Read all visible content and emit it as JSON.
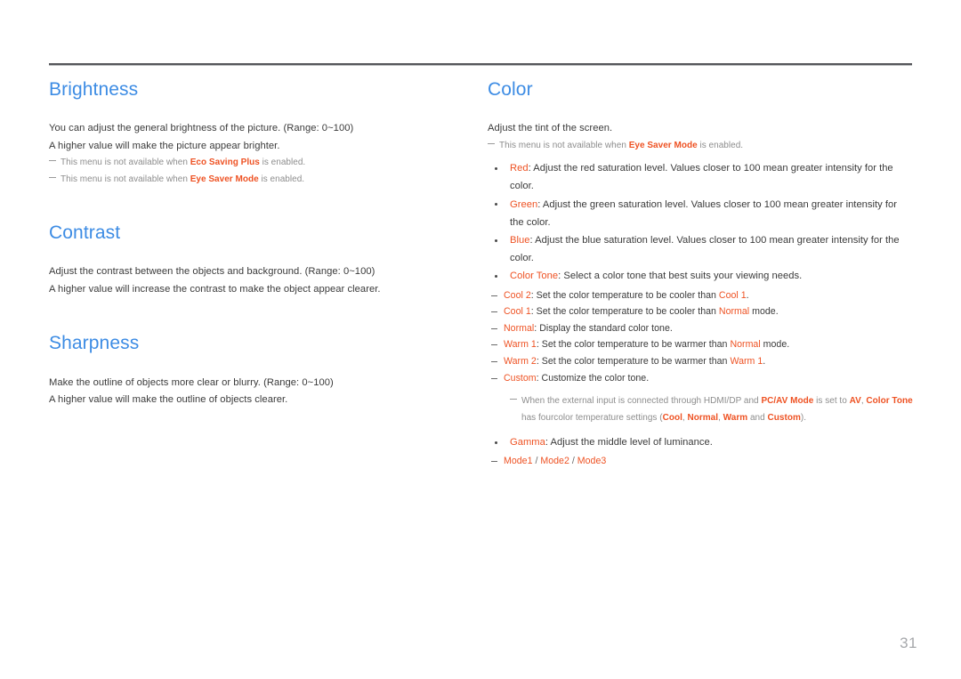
{
  "page": {
    "number": "31",
    "accent_blue": "#3d8ce4",
    "accent_orange": "#ee5223",
    "body_color": "#3a3a3a",
    "note_color": "#8d8d8d"
  },
  "left_column": {
    "sections": [
      {
        "title": "Brightness",
        "paragraphs": [
          "You can adjust the general brightness of the picture. (Range: 0~100)",
          "A higher value will make the picture appear brighter."
        ],
        "notes": [
          {
            "pre": "This menu is not available when ",
            "hl": "Eco Saving Plus",
            "post": " is enabled."
          },
          {
            "pre": "This menu is not available when ",
            "hl": "Eye Saver Mode",
            "post": " is enabled."
          }
        ]
      },
      {
        "title": "Contrast",
        "paragraphs": [
          "Adjust the contrast between the objects and background. (Range: 0~100)",
          "A higher value will increase the contrast to make the object appear clearer."
        ],
        "notes": []
      },
      {
        "title": "Sharpness",
        "paragraphs": [
          "Make the outline of objects more clear or blurry. (Range: 0~100)",
          "A higher value will make the outline of objects clearer."
        ],
        "notes": []
      }
    ]
  },
  "right_column": {
    "title": "Color",
    "intro": "Adjust the tint of the screen.",
    "intro_note": {
      "pre": "This menu is not available when ",
      "hl": "Eye Saver Mode",
      "post": " is enabled."
    },
    "bullets": {
      "red_label": "Red",
      "red_text": ": Adjust the red saturation level. Values closer to 100 mean greater intensity for the color.",
      "green_label": "Green",
      "green_text": ": Adjust the green saturation level. Values closer to 100 mean greater intensity for the color.",
      "blue_label": "Blue",
      "blue_text": ": Adjust the blue saturation level. Values closer to 100 mean greater intensity for the color.",
      "color_tone_label": "Color Tone",
      "color_tone_text": ": Select a color tone that best suits your viewing needs.",
      "gamma_label": "Gamma",
      "gamma_text": ": Adjust the middle level of luminance."
    },
    "color_tone_options": [
      {
        "label": "Cool 2",
        "pre": ": Set the color temperature to be cooler than ",
        "ref": "Cool 1",
        "post": "."
      },
      {
        "label": "Cool 1",
        "pre": ": Set the color temperature to be cooler than ",
        "ref": "Normal",
        "post": " mode."
      },
      {
        "label": "Normal",
        "pre": ": Display the standard color tone.",
        "ref": "",
        "post": ""
      },
      {
        "label": "Warm 1",
        "pre": ": Set the color temperature to be warmer than ",
        "ref": "Normal",
        "post": " mode."
      },
      {
        "label": "Warm 2",
        "pre": ": Set the color temperature to be warmer than ",
        "ref": "Warm 1",
        "post": "."
      },
      {
        "label": "Custom",
        "pre": ": Customize the color tone.",
        "ref": "",
        "post": ""
      }
    ],
    "external_input_note": {
      "t1": "When the external input is connected through HDMI/DP and ",
      "h1": "PC/AV Mode",
      "t2": " is set to ",
      "h2": "AV",
      "t3": ", ",
      "h3": "Color Tone",
      "t4": " has four",
      "t5": "color temperature settings (",
      "h4": "Cool",
      "t6": ", ",
      "h5": "Normal",
      "t7": ", ",
      "h6": "Warm",
      "t8": " and ",
      "h7": "Custom",
      "t9": ")."
    },
    "gamma_modes": {
      "mode1": "Mode1",
      "slash1": " / ",
      "mode2": "Mode2",
      "slash2": " / ",
      "mode3": "Mode3"
    }
  }
}
